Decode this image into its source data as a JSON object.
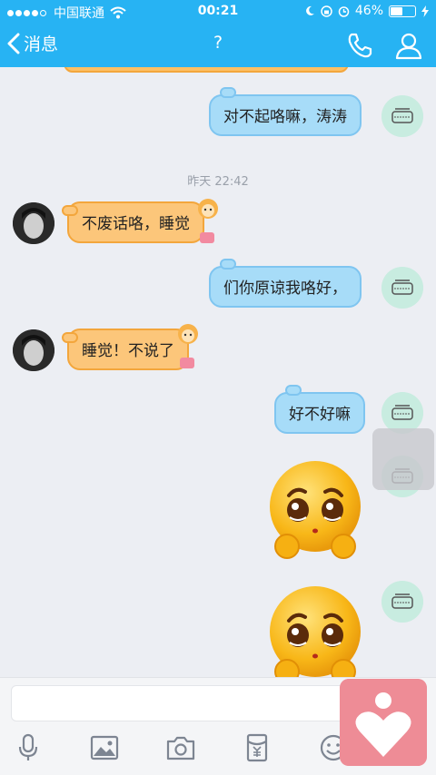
{
  "status": {
    "carrier": "中国联通",
    "time": "00:21",
    "battery": "46%",
    "battery_level": 0.46,
    "signal_dots": 4
  },
  "nav": {
    "back_label": "消息",
    "title": "?",
    "icons": [
      "phone-icon",
      "profile-icon"
    ]
  },
  "chat": {
    "timestamp": "昨天 22:42",
    "messages": [
      {
        "side": "out",
        "text": "对不起咯嘛，涛涛"
      },
      {
        "side": "in",
        "text": "不废话咯，睡觉"
      },
      {
        "side": "out",
        "text": "们你原谅我咯好，"
      },
      {
        "side": "in",
        "text": "睡觉！不说了"
      },
      {
        "side": "out",
        "text": "好不好嘛"
      },
      {
        "side": "out",
        "sticker": "pleading-face-emoji"
      },
      {
        "side": "out",
        "sticker": "pleading-face-emoji"
      }
    ]
  },
  "input": {
    "placeholder": ""
  },
  "toolbar": {
    "icons": [
      "microphone-icon",
      "image-icon",
      "camera-icon",
      "red-packet-icon",
      "emoji-icon"
    ]
  },
  "colors": {
    "brand": "#27b3f3",
    "outgoing_bubble": "#a7dcf8",
    "incoming_bubble": "#fcc67a",
    "background": "#eceef3"
  }
}
